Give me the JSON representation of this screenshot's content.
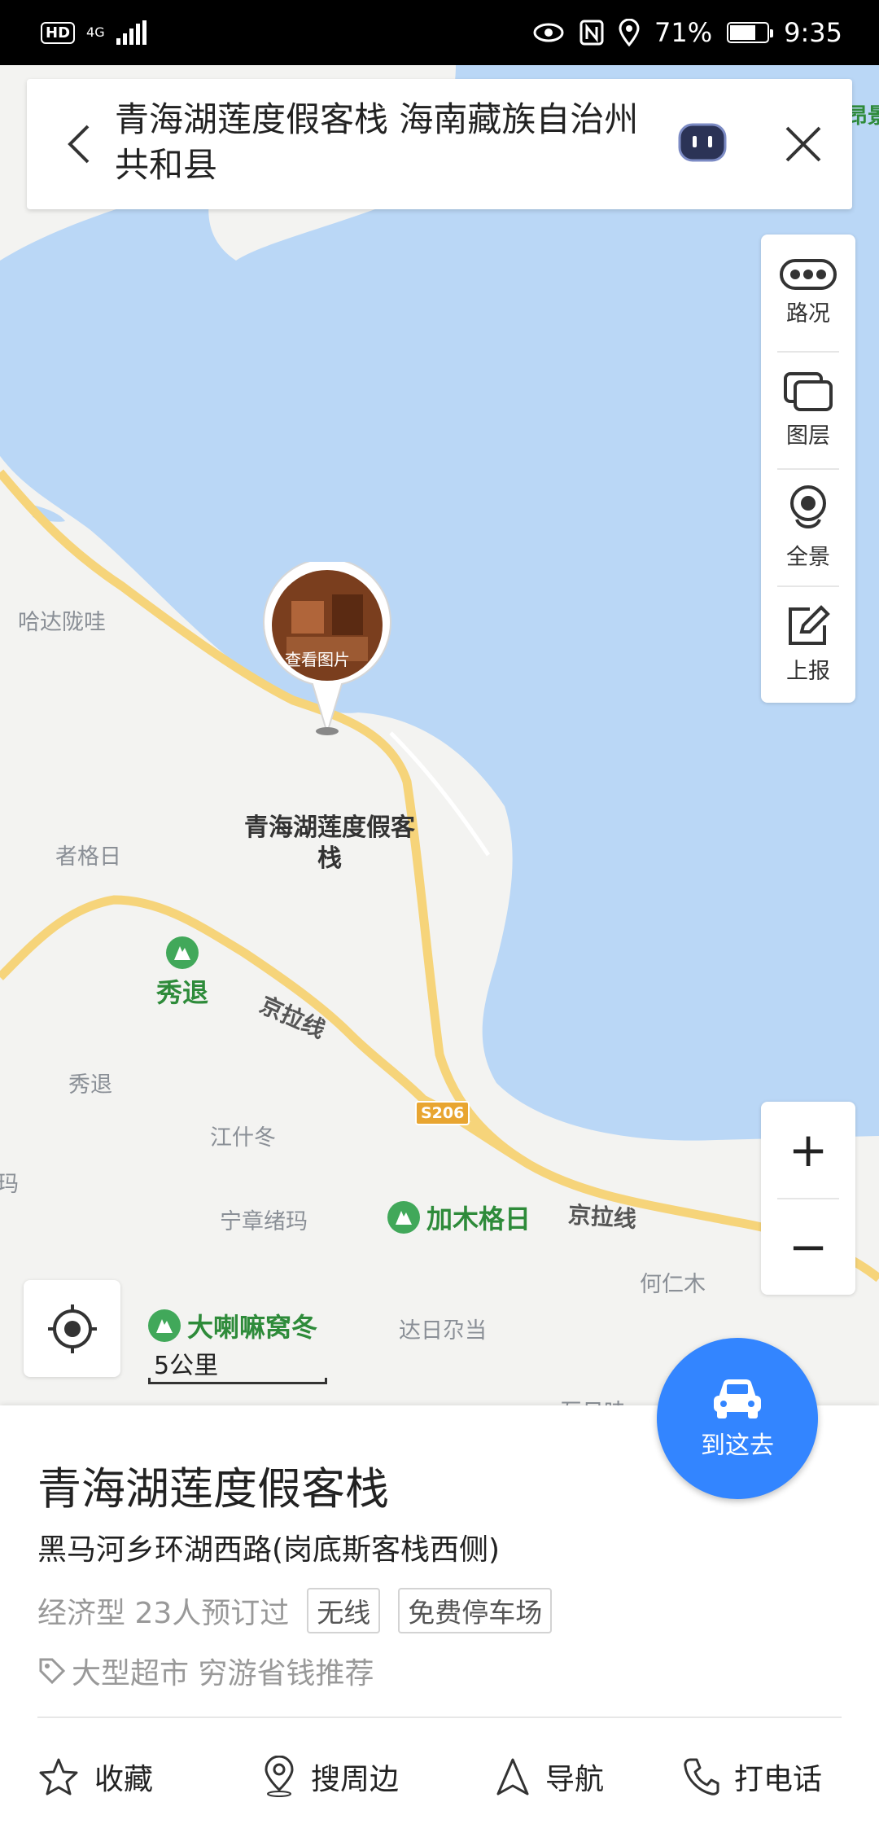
{
  "status_bar": {
    "badge": "HD",
    "network": "4G",
    "battery": "71%",
    "battery_level": 0.71,
    "time": "9:35"
  },
  "search": {
    "query": "青海湖莲度假客栈 海南藏族自治州共和县"
  },
  "tools": {
    "traffic": "路况",
    "layers": "图层",
    "panorama": "全景",
    "report": "上报"
  },
  "zoom": {
    "in": "+",
    "out": "−"
  },
  "map": {
    "marker_photo_label": "查看图片",
    "marker_name": "青海湖莲度假客栈",
    "places": {
      "hada": "哈达陇哇",
      "zhege": "者格日",
      "xiutui_village": "秀退",
      "jiangshi": "江什冬",
      "ningzhang": "宁章绪玛",
      "hereni": "何仁木",
      "dari": "达日尕当",
      "edge_left": "玛",
      "partial_bottom": "互日哇"
    },
    "scenic": {
      "xiutui": "秀退",
      "jiamu": "加木格日",
      "dalama": "大喇嘛窝冬"
    },
    "roads": {
      "jingla_1": "京拉线",
      "jingla_2": "京拉线",
      "s206": "S206"
    },
    "edge_top_right": "昂景"
  },
  "scale": {
    "label": "5公里"
  },
  "go_button": {
    "label": "到这去"
  },
  "poi": {
    "title": "青海湖莲度假客栈",
    "address": "黑马河乡环湖西路(岗底斯客栈西侧)",
    "meta": "经济型 23人预订过",
    "tags": [
      "无线",
      "免费停车场"
    ],
    "recommend": "大型超市 穷游省钱推荐"
  },
  "actions": {
    "favorite": "收藏",
    "nearby": "搜周边",
    "navigate": "导航",
    "call": "打电话"
  },
  "colors": {
    "water": "#bad7f6",
    "land": "#f3f3f1",
    "road": "#f6d47a",
    "accent": "#3385ff",
    "scenic": "#2e8b3a"
  }
}
